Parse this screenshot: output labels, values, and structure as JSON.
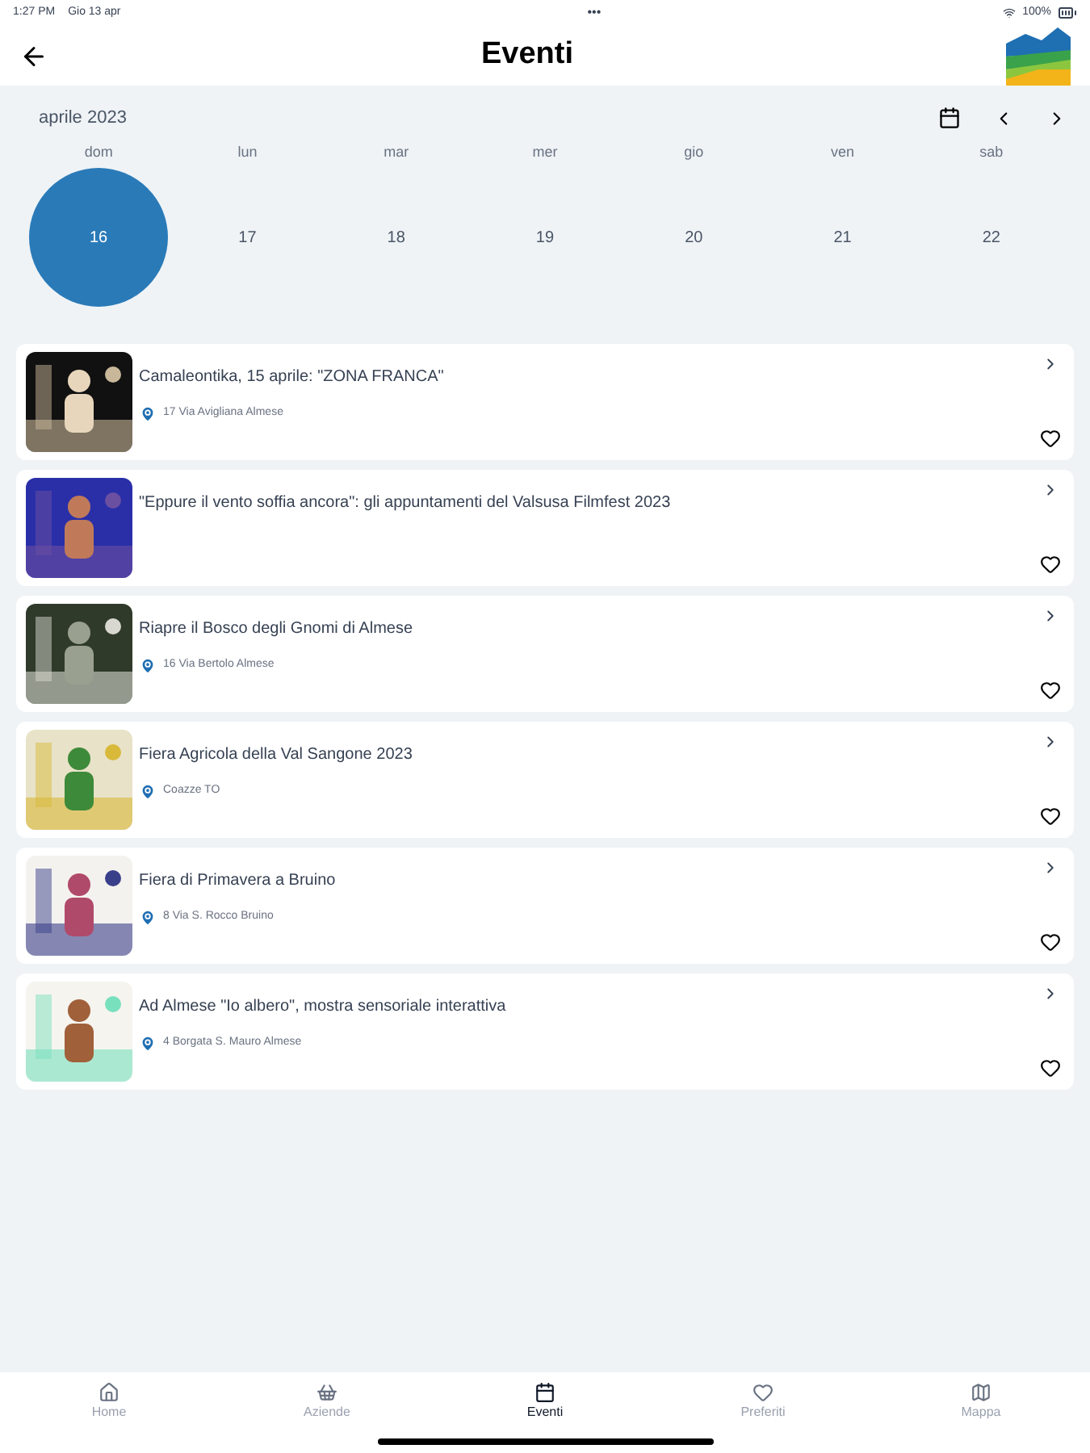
{
  "status_bar": {
    "time": "1:27 PM",
    "date": "Gio 13 apr",
    "dots": "•••",
    "battery": "100%"
  },
  "header": {
    "title": "Eventi"
  },
  "calendar": {
    "month": "aprile 2023",
    "days": [
      {
        "weekday": "dom",
        "date": "16",
        "selected": true
      },
      {
        "weekday": "lun",
        "date": "17",
        "selected": false
      },
      {
        "weekday": "mar",
        "date": "18",
        "selected": false
      },
      {
        "weekday": "mer",
        "date": "19",
        "selected": false
      },
      {
        "weekday": "gio",
        "date": "20",
        "selected": false
      },
      {
        "weekday": "ven",
        "date": "21",
        "selected": false
      },
      {
        "weekday": "sab",
        "date": "22",
        "selected": false
      }
    ]
  },
  "events": [
    {
      "title": "Camaleontika, 15 aprile: \"ZONA FRANCA\"",
      "address": "17 Via Avigliana Almese"
    },
    {
      "title": "\"Eppure il vento soffia ancora\": gli appuntamenti del Valsusa Filmfest 2023"
    },
    {
      "title": "Riapre il Bosco degli Gnomi di Almese",
      "address": "16 Via Bertolo Almese"
    },
    {
      "title": "Fiera Agricola della Val Sangone 2023",
      "address": "Coazze TO"
    },
    {
      "title": "Fiera di Primavera a Bruino",
      "address": "8 Via S. Rocco Bruino"
    },
    {
      "title": "Ad Almese \"Io albero\", mostra sensoriale interattiva",
      "address": "4 Borgata S. Mauro Almese"
    }
  ],
  "tab_bar": [
    {
      "label": "Home",
      "kind": "home",
      "selected": false
    },
    {
      "label": "Aziende",
      "kind": "basket",
      "selected": false
    },
    {
      "label": "Eventi",
      "kind": "calendar",
      "selected": true
    },
    {
      "label": "Preferiti",
      "kind": "heart",
      "selected": false
    },
    {
      "label": "Mappa",
      "kind": "map",
      "selected": false
    }
  ]
}
